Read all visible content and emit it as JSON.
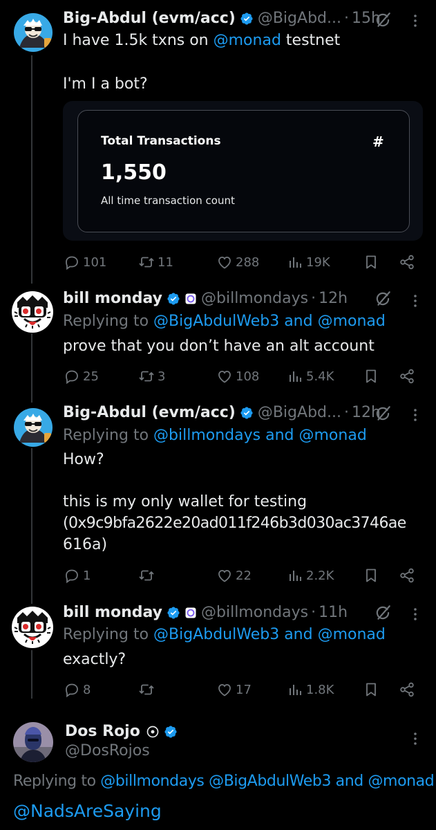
{
  "tweets": [
    {
      "name": "Big-Abdul (evm/acc)",
      "handle": "@BigAbd...",
      "time": "15h",
      "lines": [
        "I have 1.5k txns on",
        "@monad",
        "testnet",
        "I'm I a bot?"
      ],
      "card": {
        "title": "Total Transactions",
        "hash": "#",
        "value": "1,550",
        "subtitle": "All time transaction count"
      },
      "stats": {
        "replies": "101",
        "reposts": "11",
        "likes": "288",
        "views": "19K"
      }
    },
    {
      "name": "bill monday",
      "handle": "@billmondays",
      "time": "12h",
      "replying_prefix": "Replying to",
      "replying_to_1": "@BigAbdulWeb3",
      "replying_and": "and",
      "replying_to_2": "@monad",
      "text": "prove that you don’t have an alt account",
      "stats": {
        "replies": "25",
        "reposts": "3",
        "likes": "108",
        "views": "5.4K"
      }
    },
    {
      "name": "Big-Abdul (evm/acc)",
      "handle": "@BigAbd...",
      "time": "12h",
      "replying_prefix": "Replying to",
      "replying_to_1": "@billmondays",
      "replying_and": "and",
      "replying_to_2": "@monad",
      "text_1": "How?",
      "text_2": "this is my only wallet for testing",
      "text_3": "(0x9c9bfa2622e20ad011f246b3d030ac3746ae",
      "text_4": "616a)",
      "stats": {
        "replies": "1",
        "reposts": "",
        "likes": "22",
        "views": "2.2K"
      }
    },
    {
      "name": "bill monday",
      "handle": "@billmondays",
      "time": "11h",
      "replying_prefix": "Replying to",
      "replying_to_1": "@BigAbdulWeb3",
      "replying_and": "and",
      "replying_to_2": "@monad",
      "text": "exactly?",
      "stats": {
        "replies": "8",
        "reposts": "",
        "likes": "17",
        "views": "1.8K"
      }
    }
  ],
  "main": {
    "name": "Dos Rojo",
    "handle": "@DosRojos",
    "replying_prefix": "Replying to",
    "replying_to_1": "@billmondays",
    "replying_to_2": "@BigAbdulWeb3",
    "replying_and": "and",
    "replying_to_3": "@monad",
    "text": "@NadsAreSaying"
  },
  "colors": {
    "background": "#000000",
    "text": "#e7e9ea",
    "muted": "#71767b",
    "link": "#1d9bf0",
    "verified": "#1d9bf0"
  },
  "icons": [
    "verified-badge-icon",
    "grok-icon",
    "more-icon",
    "reply-icon",
    "repost-icon",
    "like-icon",
    "views-icon",
    "bookmark-icon",
    "share-icon",
    "affiliate-badge-icon"
  ]
}
